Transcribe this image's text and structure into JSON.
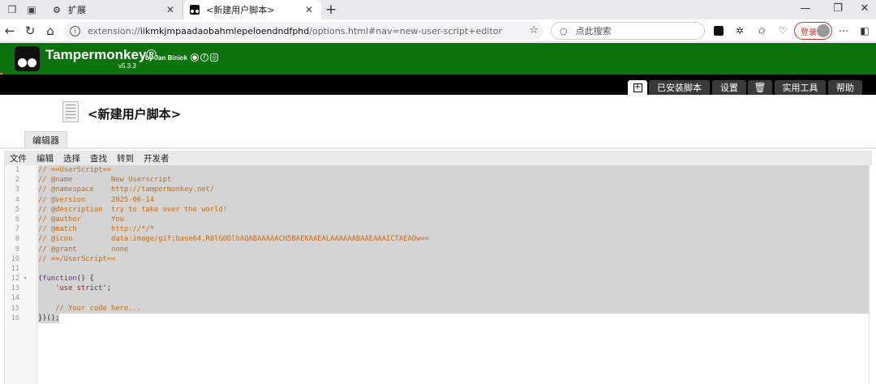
{
  "browser": {
    "tabs": [
      {
        "title": "扩展",
        "icon": "extensions-gear-icon"
      },
      {
        "title": "<新建用户脚本>",
        "icon": "tampermonkey-icon"
      }
    ],
    "url_prefix": "extension://",
    "url_host": "iikmkjmpaadaobahmlepeloendndfphd",
    "url_rest": "/options.html#nav=new-user-script+editor",
    "search_placeholder": "点此搜索",
    "login_label": "登录"
  },
  "tampermonkey": {
    "name": "Tampermonkey®",
    "by": "by Jan Biniok",
    "version": "v5.3.3",
    "brand_color": "#0b730b",
    "nav": {
      "installed": "已安装脚本",
      "settings": "设置",
      "utilities": "实用工具",
      "help": "帮助"
    }
  },
  "page": {
    "script_title": "<新建用户脚本>",
    "editor_tab": "编辑器"
  },
  "menu": [
    "文件",
    "编辑",
    "选择",
    "查找",
    "转到",
    "开发者"
  ],
  "code_lines": [
    [
      {
        "t": "cm",
        "v": "// ==UserScript=="
      }
    ],
    [
      {
        "t": "cm",
        "v": "// @name         New Userscript"
      }
    ],
    [
      {
        "t": "cm",
        "v": "// @namespace    http://tampermonkey.net/"
      }
    ],
    [
      {
        "t": "cm",
        "v": "// @version      2025-06-14"
      }
    ],
    [
      {
        "t": "cm",
        "v": "// @description  try to take over the world!"
      }
    ],
    [
      {
        "t": "cm",
        "v": "// @author       You"
      }
    ],
    [
      {
        "t": "cm",
        "v": "// @match        http://*/*"
      }
    ],
    [
      {
        "t": "cm",
        "v": "// @icon         data:image/gif;base64,R0lGODlhAQABAAAAACH5BAEKAAEALAAAAAABAAEAAAICTAEAOw=="
      }
    ],
    [
      {
        "t": "cm",
        "v": "// @grant        none"
      }
    ],
    [
      {
        "t": "cm",
        "v": "// ==/UserScript=="
      }
    ],
    [],
    [
      {
        "t": "pl",
        "v": "("
      },
      {
        "t": "kw",
        "v": "function"
      },
      {
        "t": "pl",
        "v": "() {"
      }
    ],
    [
      {
        "t": "pl",
        "v": "    "
      },
      {
        "t": "st",
        "v": "'use strict'"
      },
      {
        "t": "pl",
        "v": ";"
      }
    ],
    [],
    [
      {
        "t": "pl",
        "v": "    "
      },
      {
        "t": "cm",
        "v": "// Your code here..."
      }
    ],
    [
      {
        "t": "pl",
        "v": "})();"
      }
    ]
  ]
}
